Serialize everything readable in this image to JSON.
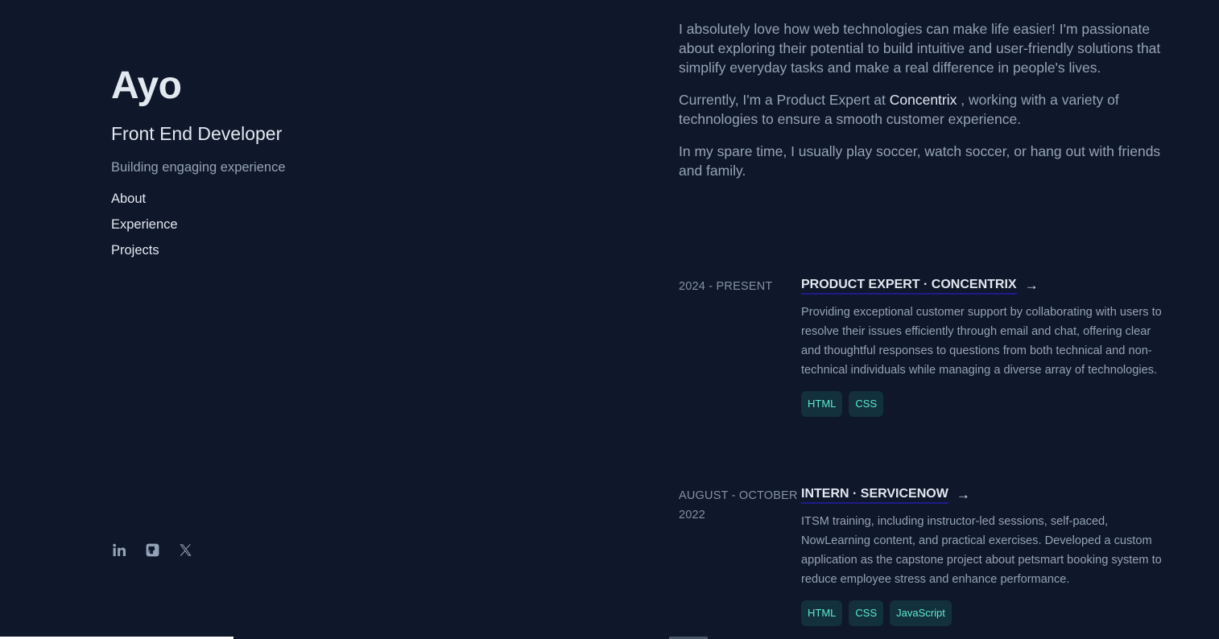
{
  "profile": {
    "name": "Ayo",
    "role": "Front End Developer",
    "tagline": "Building engaging experience"
  },
  "nav": {
    "items": [
      {
        "label": "About"
      },
      {
        "label": "Experience"
      },
      {
        "label": "Projects"
      }
    ]
  },
  "socials": [
    {
      "icon": "linkedin-icon"
    },
    {
      "icon": "github-icon"
    },
    {
      "icon": "x-icon"
    }
  ],
  "about": {
    "p1": "I absolutely love how web technologies can make life easier! I'm passionate about exploring their potential to build intuitive and user-friendly solutions that simplify everyday tasks and make a real difference in people's lives.",
    "p2_before": "Currently, I'm a Product Expert at ",
    "p2_highlight": "Concentrix",
    "p2_after": " , working with a variety of technologies to ensure a smooth customer experience.",
    "p3": "In my spare time, I usually play soccer, watch soccer, or hang out with friends and family."
  },
  "experience": [
    {
      "date": "2024 - PRESENT",
      "title": "PRODUCT EXPERT · CONCENTRIX",
      "arrow": "→",
      "description": "Providing exceptional customer support by collaborating with users to resolve their issues efficiently through email and chat, offering clear and thoughtful responses to questions from both technical and non-technical individuals while managing a diverse array of technologies.",
      "tags": [
        "HTML",
        "CSS"
      ]
    },
    {
      "date": "AUGUST - OCTOBER 2022",
      "title": "INTERN · SERVICENOW",
      "arrow": "→",
      "description": "ITSM training, including instructor-led sessions, self-paced, NowLearning content, and practical exercises. Developed a custom application as the capstone project about petsmart booking system to reduce employee stress and enhance performance.",
      "tags": [
        "HTML",
        "CSS",
        "JavaScript"
      ]
    }
  ],
  "colors": {
    "background": "#0f172a",
    "text": "#94a3b8",
    "heading": "#e2e8f0",
    "tag_bg": "#13303d",
    "tag_text": "#5eead4"
  }
}
